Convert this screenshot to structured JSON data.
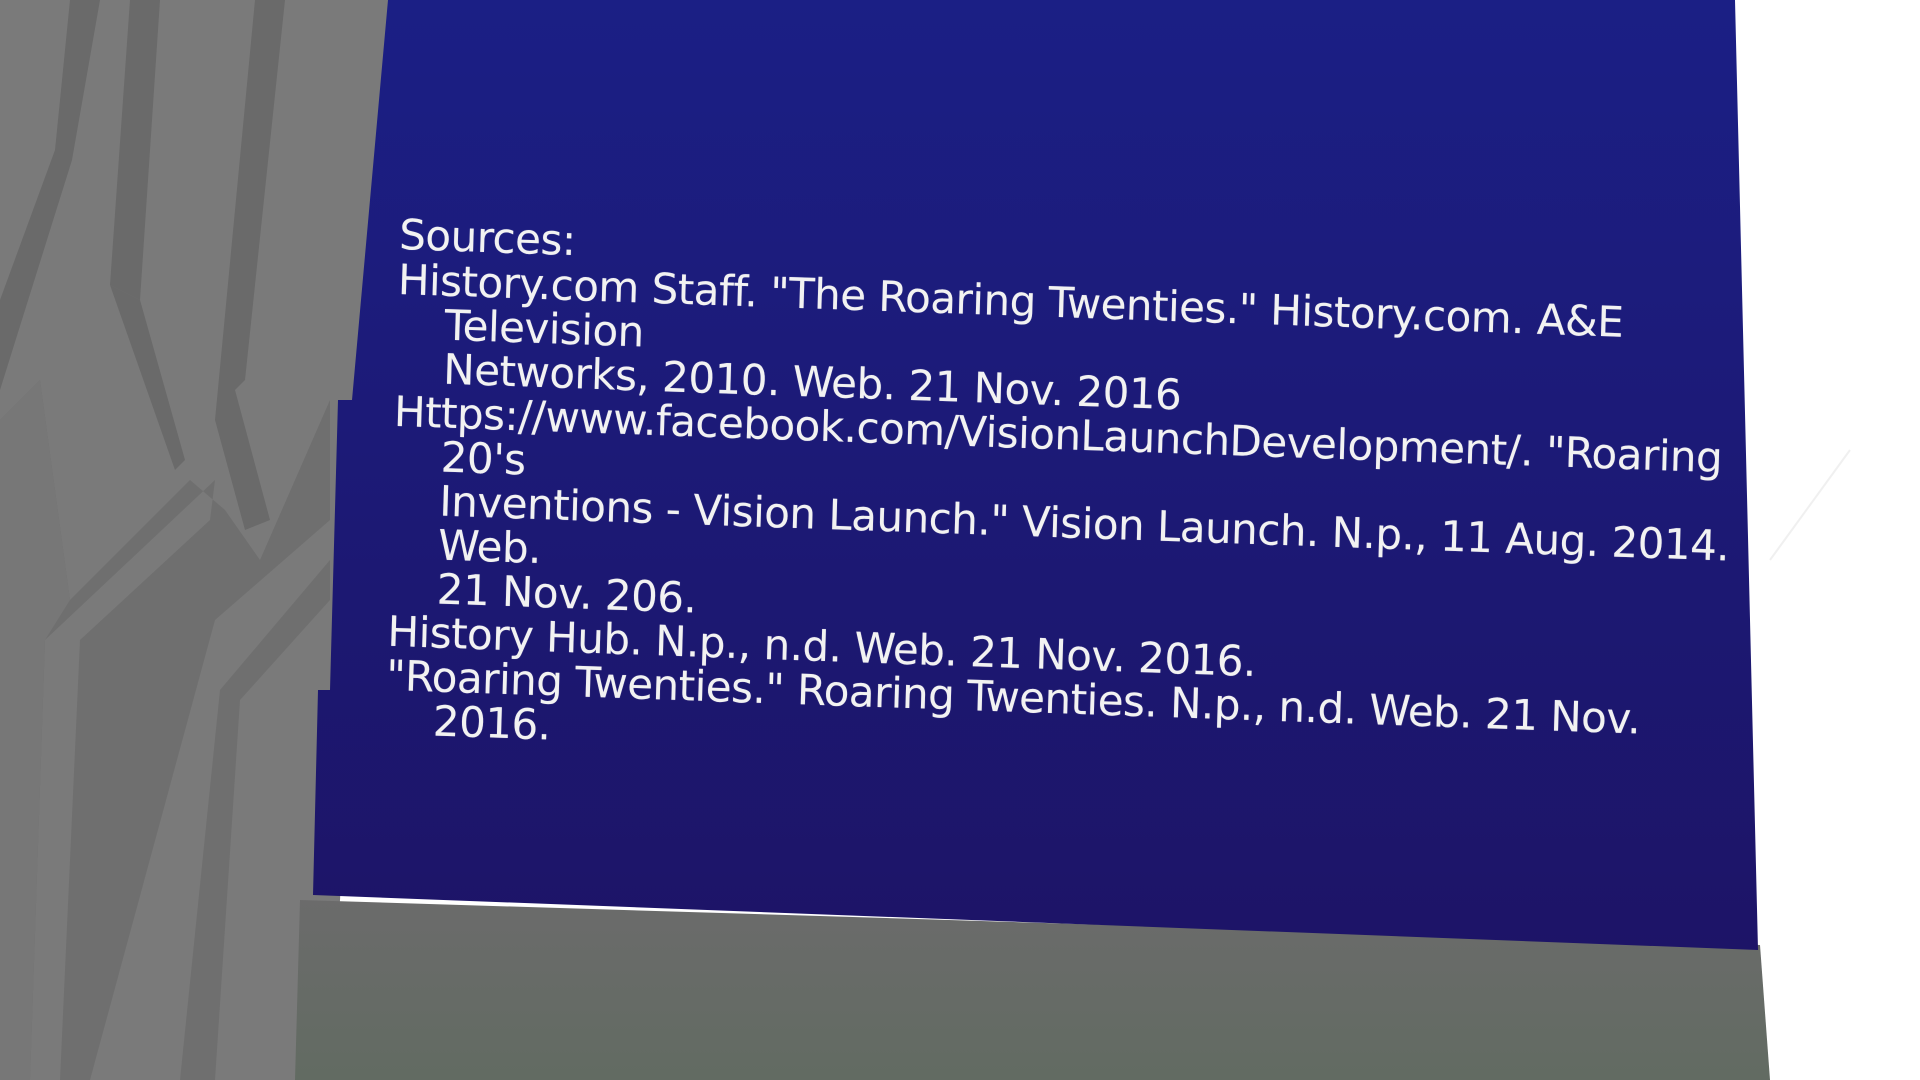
{
  "slide": {
    "background_color": "#1b1b7c",
    "heading": "Sources:",
    "citations": [
      "History.com Staff. \"The Roaring Twenties.\" History.com. A&E Television\nNetworks, 2010. Web. 21 Nov. 2016",
      "Https://www.facebook.com/VisionLaunchDevelopment/. \"Roaring 20's\nInventions - Vision Launch.\" Vision Launch. N.p., 11 Aug. 2014. Web.\n21 Nov. 206.",
      "History Hub. N.p., n.d. Web. 21 Nov. 2016.",
      "\"Roaring Twenties.\" Roaring Twenties. N.p., n.d. Web. 21 Nov. 2016."
    ]
  },
  "colors": {
    "wall_gray": "#7a7a7a",
    "wall_stripe": "#6a6a6a",
    "floor_gray": "#6b6b6b",
    "floor_green": "#5f6b5f",
    "slide_top": "#1b1f85",
    "slide_bottom": "#1d1467",
    "text": "#f2f2f2"
  }
}
